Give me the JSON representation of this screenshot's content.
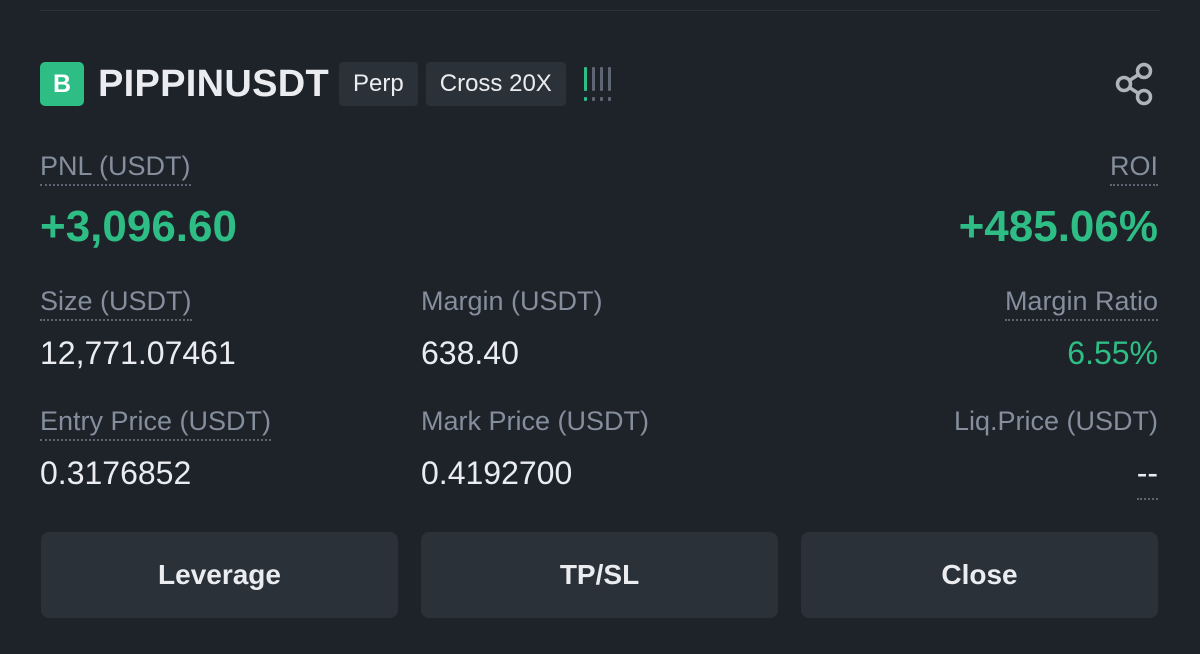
{
  "position": {
    "side_badge": "B",
    "symbol": "PIPPINUSDT",
    "type_tag": "Perp",
    "margin_tag": "Cross 20X",
    "risk_level": {
      "filled": 1,
      "total": 4
    },
    "share_icon": "share-icon"
  },
  "pnl": {
    "label": "PNL (USDT)",
    "value": "+3,096.60"
  },
  "roi": {
    "label": "ROI",
    "value": "+485.06%"
  },
  "size": {
    "label": "Size (USDT)",
    "value": "12,771.07461"
  },
  "margin": {
    "label": "Margin (USDT)",
    "value": "638.40"
  },
  "margin_ratio": {
    "label": "Margin Ratio",
    "value": "6.55%"
  },
  "entry_price": {
    "label": "Entry Price (USDT)",
    "value": "0.3176852"
  },
  "mark_price": {
    "label": "Mark Price (USDT)",
    "value": "0.4192700"
  },
  "liq_price": {
    "label": "Liq.Price (USDT)",
    "value": "--"
  },
  "actions": {
    "leverage": "Leverage",
    "tpsl": "TP/SL",
    "close": "Close"
  },
  "colors": {
    "profit": "#2ebd85",
    "background": "#1e2229",
    "button": "#2b3139"
  }
}
